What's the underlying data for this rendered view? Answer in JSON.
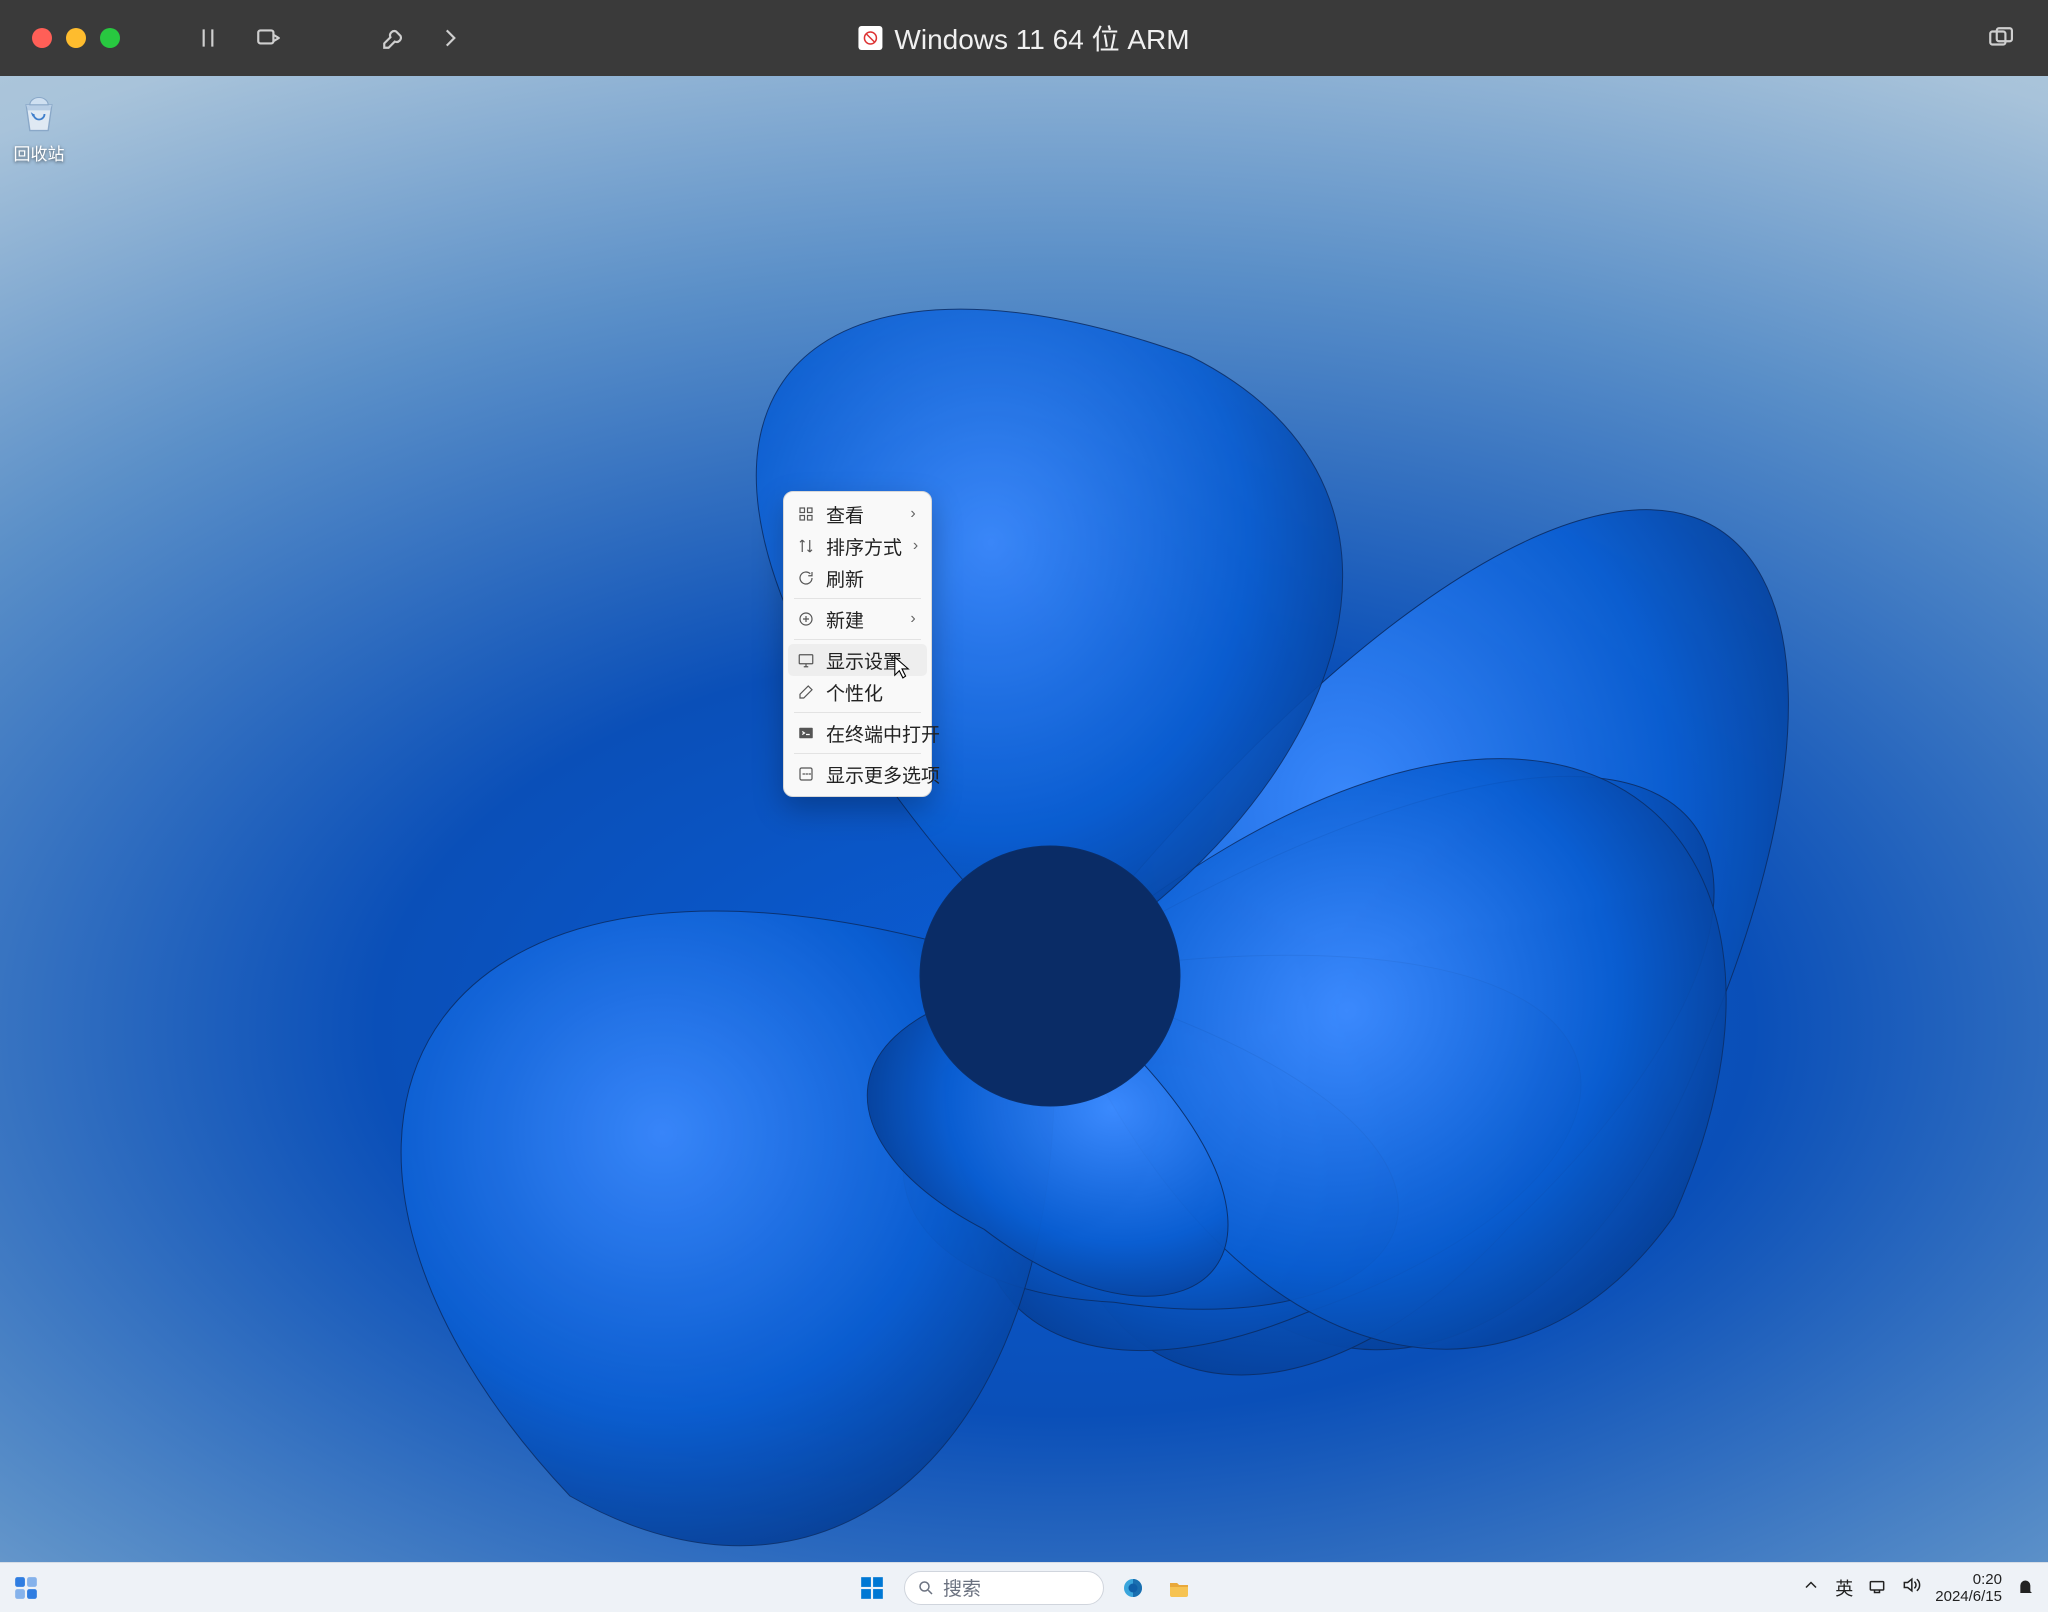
{
  "vm_window": {
    "title": "Windows 11 64 位 ARM"
  },
  "desktop": {
    "recycle_bin_label": "回收站"
  },
  "context_menu": {
    "items": [
      {
        "icon": "grid",
        "label": "查看",
        "submenu": true
      },
      {
        "icon": "sort",
        "label": "排序方式",
        "submenu": true
      },
      {
        "icon": "refresh",
        "label": "刷新",
        "submenu": false
      },
      {
        "sep": true
      },
      {
        "icon": "plus",
        "label": "新建",
        "submenu": true
      },
      {
        "sep": true
      },
      {
        "icon": "display",
        "label": "显示设置",
        "submenu": false,
        "hovered": true
      },
      {
        "icon": "brush",
        "label": "个性化",
        "submenu": false
      },
      {
        "sep": true
      },
      {
        "icon": "terminal",
        "label": "在终端中打开",
        "submenu": false
      },
      {
        "sep": true
      },
      {
        "icon": "more",
        "label": "显示更多选项",
        "submenu": false
      }
    ]
  },
  "taskbar": {
    "search_placeholder": "搜索",
    "ime_label": "英",
    "time": "0:20",
    "date": "2024/6/15"
  }
}
